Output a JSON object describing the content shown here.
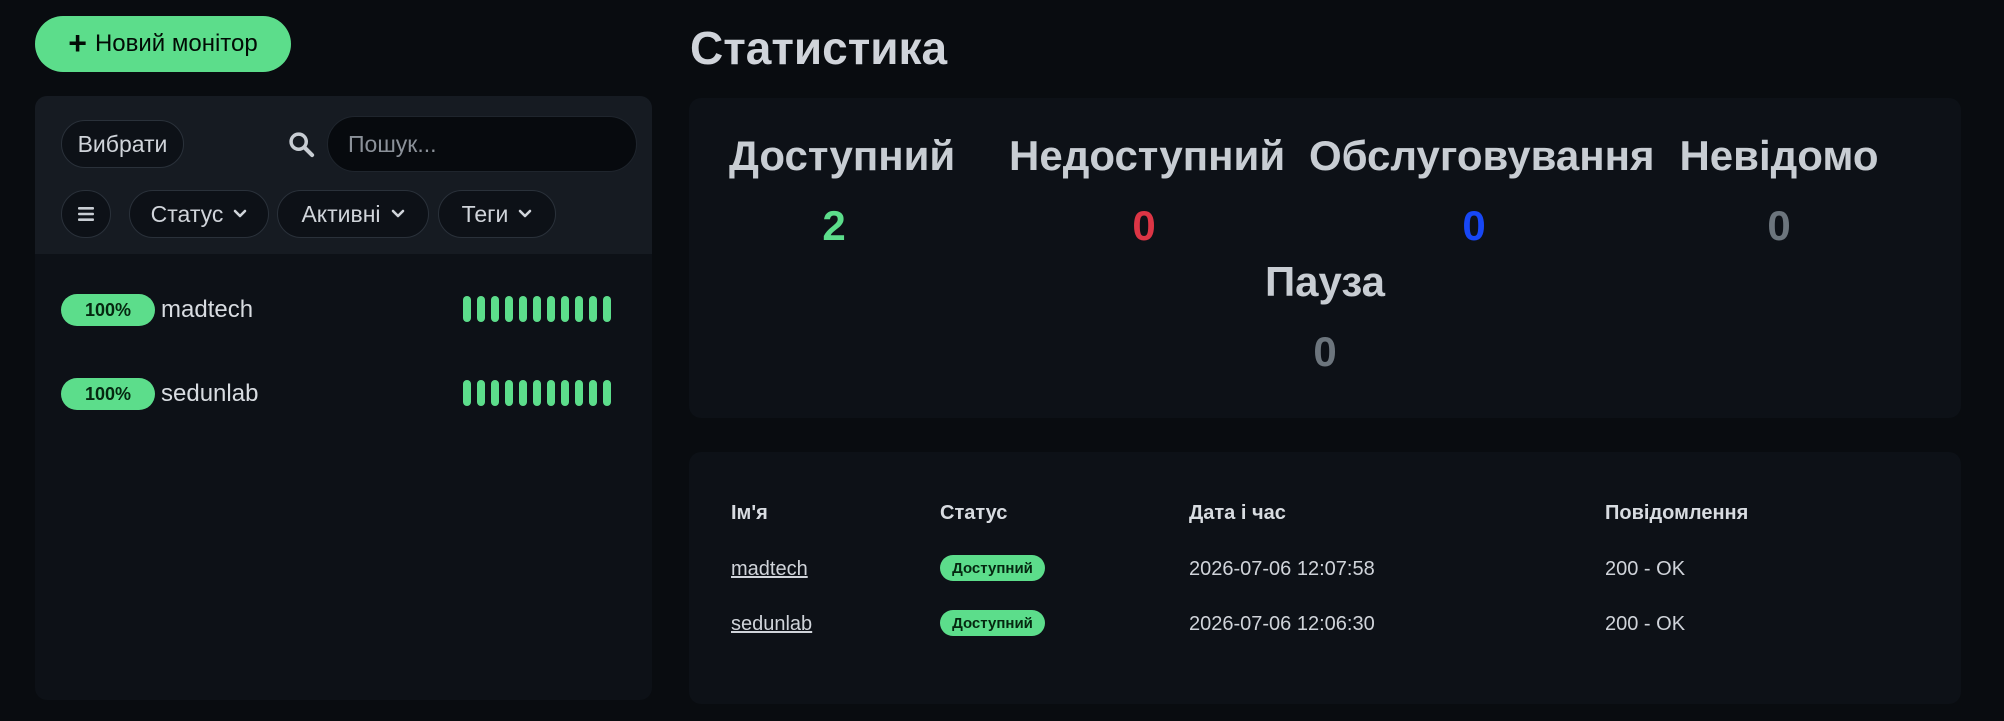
{
  "sidebar": {
    "new_monitor_label": "Новий монітор",
    "select_label": "Вибрати",
    "search_placeholder": "Пошук...",
    "filters": {
      "status_label": "Статус",
      "active_label": "Активні",
      "tags_label": "Теги"
    },
    "monitors": [
      {
        "uptime": "100%",
        "name": "madtech",
        "beats": 11,
        "beat_status": "up"
      },
      {
        "uptime": "100%",
        "name": "sedunlab",
        "beats": 11,
        "beat_status": "up"
      }
    ]
  },
  "main": {
    "title": "Статистика",
    "stats": [
      {
        "label": "Доступний",
        "value": "2",
        "color": "#5cdd8b"
      },
      {
        "label": "Недоступний",
        "value": "0",
        "color": "#dc3545"
      },
      {
        "label": "Обслуговування",
        "value": "0",
        "color": "#1747f5"
      },
      {
        "label": "Невідомо",
        "value": "0",
        "color": "#6c757d"
      },
      {
        "label": "Пауза",
        "value": "0",
        "color": "#6c757d"
      }
    ],
    "events": {
      "columns": [
        "Ім'я",
        "Статус",
        "Дата і час",
        "Повідомлення"
      ],
      "rows": [
        {
          "name": "madtech",
          "status": "Доступний",
          "datetime": "2026-07-06 12:07:58",
          "message": "200 - OK"
        },
        {
          "name": "sedunlab",
          "status": "Доступний",
          "datetime": "2026-07-06 12:06:30",
          "message": "200 - OK"
        }
      ]
    }
  },
  "colors": {
    "accent_green": "#5cdd8b",
    "background": "#090c10",
    "panel": "#0d1117"
  },
  "icons": [
    "plus-icon",
    "search-icon",
    "list-icon",
    "chevron-down-icon"
  ]
}
